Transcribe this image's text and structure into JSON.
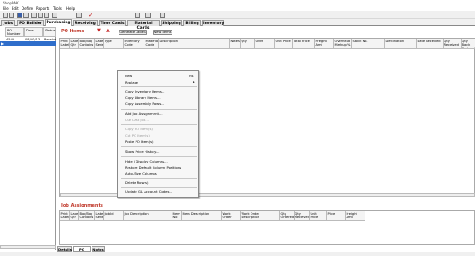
{
  "window": {
    "title": "ShopPAK"
  },
  "menu": [
    "File",
    "Edit",
    "Define",
    "Reports",
    "Tools",
    "Help"
  ],
  "toolbar": {
    "icons": [
      "new-icon",
      "open-icon",
      "save-icon",
      "print-icon",
      "cut-icon",
      "copy-icon",
      "paste-icon",
      "undo-icon",
      "check-icon",
      "delete-icon",
      "calculator-icon",
      "report-icon",
      "camera-icon"
    ]
  },
  "tabs": [
    {
      "label": "Jobs"
    },
    {
      "label": "PO Builder"
    },
    {
      "label": "Purchasing",
      "active": true
    },
    {
      "label": "Receiving"
    },
    {
      "label": "Time Cards"
    },
    {
      "label": "Material Cards"
    },
    {
      "label": "Shipping"
    },
    {
      "label": "Billing"
    },
    {
      "label": "Inventory"
    }
  ],
  "po_list": {
    "headers": [
      "PO Number",
      "Date",
      "Status"
    ],
    "rows": [
      [
        "4542",
        "08/20/13",
        "Received"
      ]
    ]
  },
  "po_items": {
    "title": "PO Items",
    "buttons": {
      "generate": "Generate Labels",
      "new_item": "New Items"
    },
    "headers": [
      "Print Label",
      "Label Qty",
      "Box/Bag Contains",
      "Label Series",
      "Type",
      "Inventory Code",
      "Material Code",
      "Description",
      "Notes",
      "Qty",
      "UOM",
      "Unit Price",
      "Total Price",
      "Freight Amt",
      "Overhead Markup %",
      "Stock No.",
      "Destination",
      "Date Received",
      "Qty Received",
      "Qty Back Ordered"
    ]
  },
  "context_menu": {
    "items": [
      {
        "label": "New",
        "shortcut": "Ins"
      },
      {
        "label": "Replace",
        "submenu": true
      },
      {
        "sep": true
      },
      {
        "label": "Copy Inventory Items..."
      },
      {
        "label": "Copy Library Items..."
      },
      {
        "label": "Copy Assembly Rows..."
      },
      {
        "sep": true
      },
      {
        "label": "Add Job Assignment..."
      },
      {
        "label": "Use Last Job...",
        "disabled": true
      },
      {
        "sep": true
      },
      {
        "label": "Copy PO Item(s)",
        "disabled": true
      },
      {
        "label": "Cut PO Item(s)",
        "disabled": true
      },
      {
        "label": "Paste PO Item(s)"
      },
      {
        "sep": true
      },
      {
        "label": "Show Price History..."
      },
      {
        "sep": true
      },
      {
        "label": "Hide / Display Columns..."
      },
      {
        "label": "Restore Default Column Positions"
      },
      {
        "label": "Auto-Size Columns"
      },
      {
        "sep": true
      },
      {
        "label": "Delete Row(s)"
      },
      {
        "sep": true
      },
      {
        "label": "Update GL Account Codes..."
      }
    ]
  },
  "job_assignments": {
    "title": "Job Assignments",
    "headers": [
      "Print Label",
      "Label Qty",
      "Box/Bag Contains",
      "Label Series",
      "Job Id",
      "Job Description",
      "Item No",
      "Item Description",
      "Work Order",
      "Work Order Description",
      "Qty Ordered",
      "Qty Received",
      "Unit Price",
      "Price",
      "Freight Amt"
    ]
  },
  "bottom_tabs": [
    {
      "label": "Details"
    },
    {
      "label": "PO Items",
      "active": true
    },
    {
      "label": "Notes"
    }
  ]
}
